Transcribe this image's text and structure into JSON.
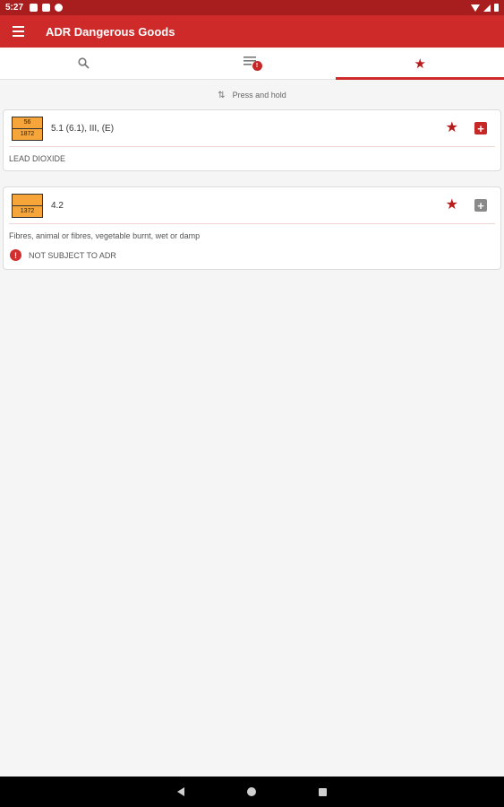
{
  "status_bar": {
    "time": "5:27"
  },
  "app_bar": {
    "title": "ADR Dangerous Goods",
    "menu_icon": "hamburger-menu-icon"
  },
  "tabs": [
    {
      "icon": "search-icon",
      "active": false
    },
    {
      "icon": "list-icon",
      "badge": "!",
      "active": false
    },
    {
      "icon": "star-icon",
      "active": true
    }
  ],
  "hint": {
    "icon": "sort-icon",
    "text": "Press and hold"
  },
  "items": [
    {
      "plate_top": "56",
      "plate_bottom": "1872",
      "class_text": "5.1 (6.1), III, (E)",
      "name": "LEAD DIOXIDE",
      "note": ""
    },
    {
      "plate_top": "",
      "plate_bottom": "1372",
      "class_text": "4.2",
      "name": "Fibres, animal or fibres, vegetable burnt, wet or damp",
      "note": "NOT SUBJECT TO ADR"
    }
  ],
  "colors": {
    "primary": "#cf2a2a",
    "status_bar": "#a81d1d",
    "plate_orange": "#f6a53a",
    "star": "#b71c1c"
  }
}
